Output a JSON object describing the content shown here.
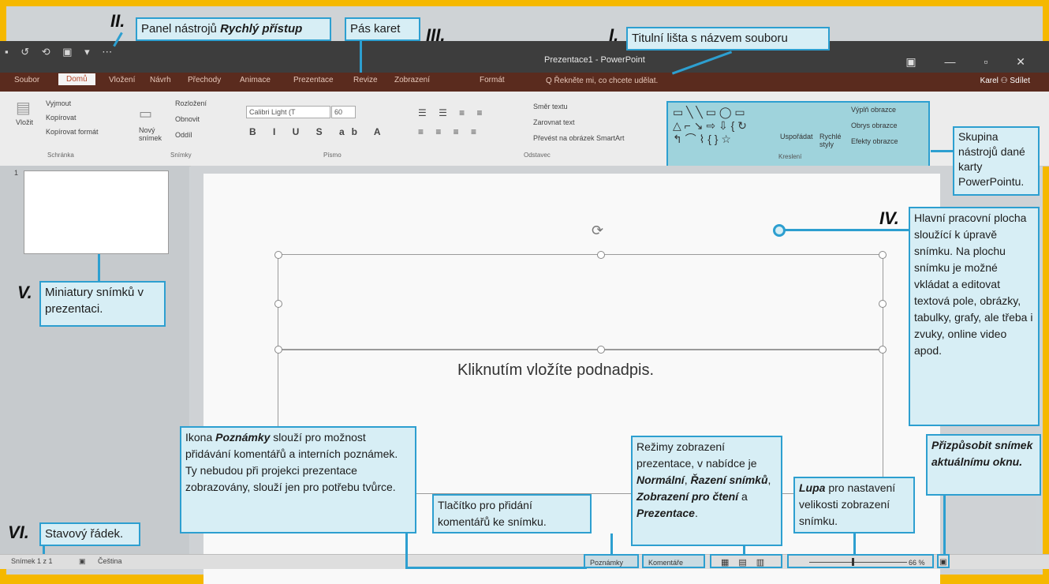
{
  "window": {
    "qat_icons": "▪ ↺ ⟲ ▣ ▾ ⋯",
    "title": "Prezentace1 - PowerPoint",
    "controls": "▣ — ▫ ✕",
    "tell_me": "Q Řekněte mi, co chcete udělat.",
    "user": "Karel  ⚇ Sdílet"
  },
  "tabs": [
    "Soubor",
    "Domů",
    "Vložení",
    "Návrh",
    "Přechody",
    "Animace",
    "Prezentace",
    "Revize",
    "Zobrazení",
    "Formát"
  ],
  "ribbon": {
    "paste": "Vložit",
    "cut": "Vyjmout",
    "copy": "Kopírovat",
    "format_painter": "Kopírovat formát",
    "new_slide": "Nový snímek",
    "layout": "Rozložení",
    "reset": "Obnovit",
    "section": "Oddíl",
    "font_name": "Calibri Light (T",
    "font_size": "60",
    "text_direction": "Směr textu",
    "align_text": "Zarovnat text",
    "smartart": "Převést na obrázek SmartArt",
    "arrange": "Uspořádat",
    "quick_styles": "Rychlé styly",
    "shape_fill": "Výplň obrazce",
    "shape_outline": "Obrys obrazce",
    "shape_effects": "Efekty obrazce",
    "groups": [
      "Schránka",
      "Snímky",
      "Písmo",
      "Odstavec",
      "Kreslení"
    ]
  },
  "slide": {
    "subtitle_placeholder": "Kliknutím vložíte podnadpis.",
    "thumb_number": "1"
  },
  "status": {
    "slide_info": "Snímek 1 z 1",
    "language": "Čeština",
    "notes": "Poznámky",
    "comments": "Komentáře",
    "zoom": "66 %"
  },
  "annotations": {
    "n1": "I.",
    "t1": "Titulní lišta s názvem souboru",
    "n2": "II.",
    "t2a": "Panel nástrojů ",
    "t2b": "Rychlý přístup",
    "n3": "III.",
    "t3": "Pás karet",
    "n4": "IV.",
    "t4": "Hlavní pracovní plocha sloužící k úpravě snímku. Na plochu snímku je možné vkládat a editovat textová pole, obrázky, tabulky, grafy, ale třeba i zvuky, online video apod.",
    "n5": "V.",
    "t5": "Miniatury snímků v prezentaci.",
    "n6": "VI.",
    "t6": "Stavový řádek.",
    "group": "Skupina nástrojů dané karty PowerPointu.",
    "notes_a": "Ikona ",
    "notes_b": "Poznámky",
    "notes_c": " slouží pro možnost přidávání komentářů a interních poznámek. Ty nebudou při projekci prezentace zobrazovány, slouží jen pro potřebu tvůrce.",
    "comment": "Tlačítko pro přidání komentářů ke snímku.",
    "views_a": "Režimy zobrazení prezentace, v nabídce je ",
    "views_b": "Normální",
    "views_c": ", ",
    "views_d": "Řazení snímků",
    "views_e": ", ",
    "views_f": "Zobrazení pro čtení",
    "views_g": " a ",
    "views_h": "Prezentace",
    "views_i": ".",
    "zoom_a": "Lupa",
    "zoom_b": " pro nastavení velikosti zobrazení snímku.",
    "fit": "Přizpůsobit snímek aktuálnímu oknu."
  }
}
